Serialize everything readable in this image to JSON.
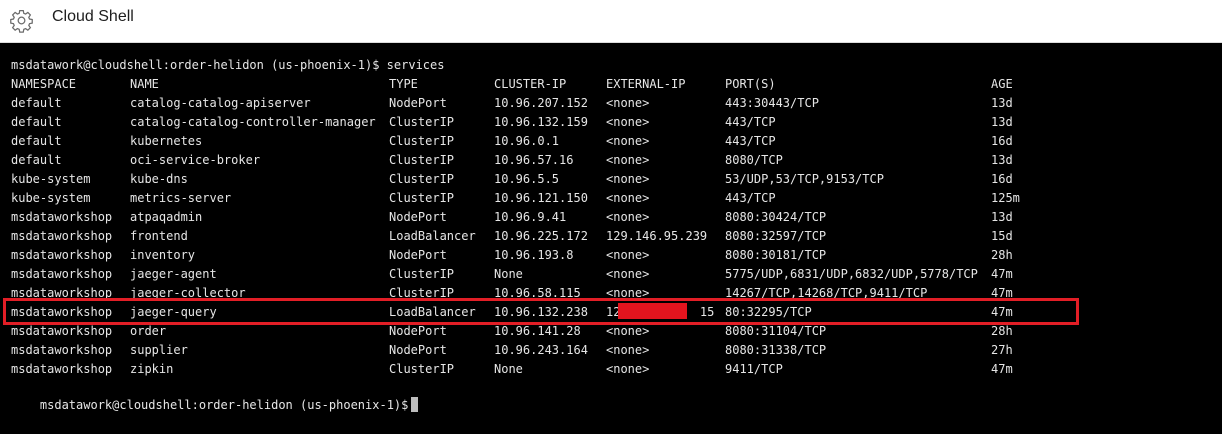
{
  "header": {
    "title": "Cloud Shell",
    "icon": "gear-icon"
  },
  "terminal": {
    "prompt_command": "msdatawork@cloudshell:order-helidon (us-phoenix-1)$ services",
    "columns": [
      "NAMESPACE",
      "NAME",
      "TYPE",
      "CLUSTER-IP",
      "EXTERNAL-IP",
      "PORT(S)",
      "AGE"
    ],
    "rows": [
      [
        "default",
        "catalog-catalog-apiserver",
        "NodePort",
        "10.96.207.152",
        "<none>",
        "443:30443/TCP",
        "13d"
      ],
      [
        "default",
        "catalog-catalog-controller-manager",
        "ClusterIP",
        "10.96.132.159",
        "<none>",
        "443/TCP",
        "13d"
      ],
      [
        "default",
        "kubernetes",
        "ClusterIP",
        "10.96.0.1",
        "<none>",
        "443/TCP",
        "16d"
      ],
      [
        "default",
        "oci-service-broker",
        "ClusterIP",
        "10.96.57.16",
        "<none>",
        "8080/TCP",
        "13d"
      ],
      [
        "kube-system",
        "kube-dns",
        "ClusterIP",
        "10.96.5.5",
        "<none>",
        "53/UDP,53/TCP,9153/TCP",
        "16d"
      ],
      [
        "kube-system",
        "metrics-server",
        "ClusterIP",
        "10.96.121.150",
        "<none>",
        "443/TCP",
        "125m"
      ],
      [
        "msdataworkshop",
        "atpaqadmin",
        "NodePort",
        "10.96.9.41",
        "<none>",
        "8080:30424/TCP",
        "13d"
      ],
      [
        "msdataworkshop",
        "frontend",
        "LoadBalancer",
        "10.96.225.172",
        "129.146.95.239",
        "8080:32597/TCP",
        "15d"
      ],
      [
        "msdataworkshop",
        "inventory",
        "NodePort",
        "10.96.193.8",
        "<none>",
        "8080:30181/TCP",
        "28h"
      ],
      [
        "msdataworkshop",
        "jaeger-agent",
        "ClusterIP",
        "None",
        "<none>",
        "5775/UDP,6831/UDP,6832/UDP,5778/TCP",
        "47m"
      ],
      [
        "msdataworkshop",
        "jaeger-collector",
        "ClusterIP",
        "10.96.58.115",
        "<none>",
        "14267/TCP,14268/TCP,9411/TCP",
        "47m"
      ],
      [
        "msdataworkshop",
        "jaeger-query",
        "LoadBalancer",
        "10.96.132.238",
        "12           15",
        "80:32295/TCP",
        "47m"
      ],
      [
        "msdataworkshop",
        "order",
        "NodePort",
        "10.96.141.28",
        "<none>",
        "8080:31104/TCP",
        "28h"
      ],
      [
        "msdataworkshop",
        "supplier",
        "NodePort",
        "10.96.243.164",
        "<none>",
        "8080:31338/TCP",
        "27h"
      ],
      [
        "msdataworkshop",
        "zipkin",
        "ClusterIP",
        "None",
        "<none>",
        "9411/TCP",
        "47m"
      ]
    ],
    "final_prompt": "msdatawork@cloudshell:order-helidon (us-phoenix-1)$",
    "highlight_color": "#e21e26"
  }
}
